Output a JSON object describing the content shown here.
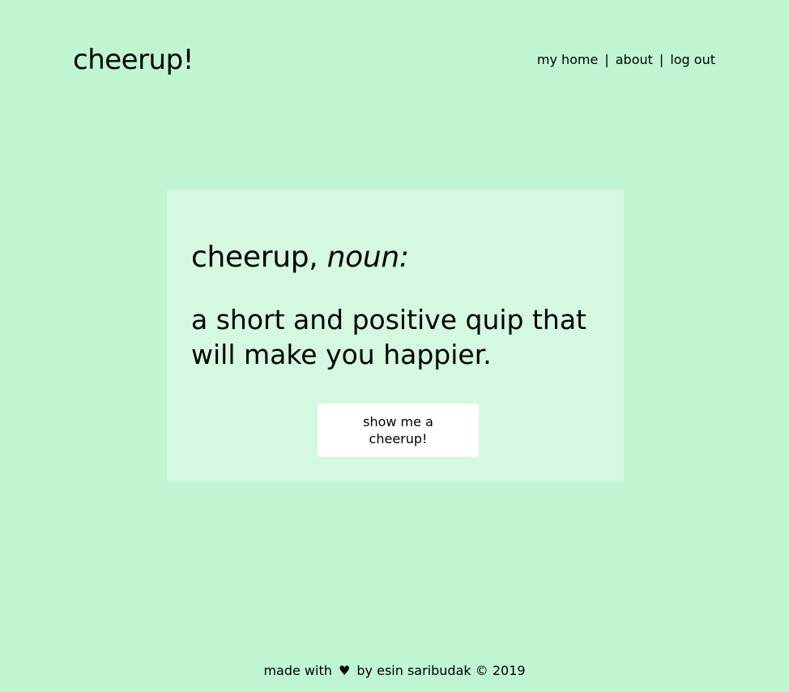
{
  "header": {
    "logo": "cheerup!",
    "nav": {
      "home": "my home",
      "about": "about",
      "logout": "log out",
      "separator": "|"
    }
  },
  "card": {
    "headline_word": "cheerup,",
    "headline_pos": "noun:",
    "definition": "a short and positive quip that will make you happier.",
    "button_label": "show me a cheerup!"
  },
  "footer": {
    "made_with": "made with",
    "heart": "♥",
    "by": "by",
    "author": "esin saribudak",
    "copyright": "© 2019"
  },
  "colors": {
    "page_background": "#c0f5d1",
    "card_background": "#d4f8e0",
    "button_background": "#ffffff",
    "text": "#000000"
  }
}
